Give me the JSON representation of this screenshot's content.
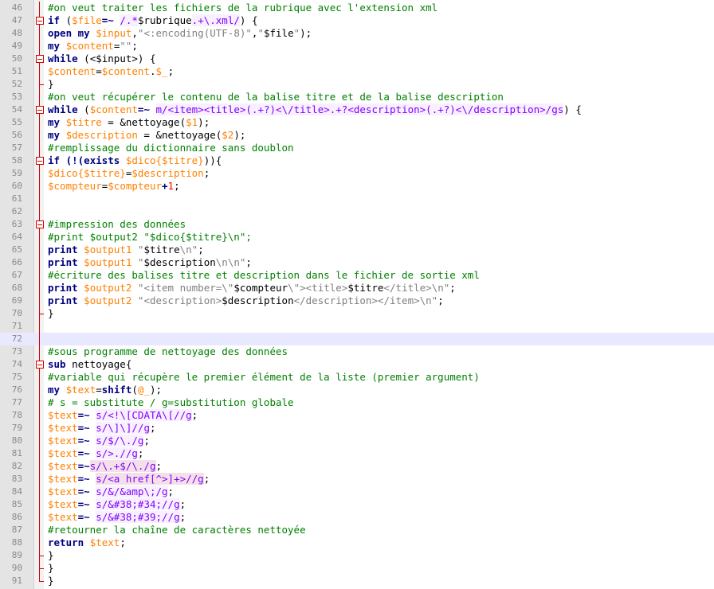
{
  "editor": {
    "colors": {
      "keyword": "#000080",
      "comment": "#008000",
      "variable": "#ff8000",
      "string": "#808080",
      "regex": "#8000ff",
      "fold_marker": "#d00000",
      "current_line": "#e8e8ff",
      "gutter": "#e4e4e4"
    },
    "current_line_number": 72,
    "lines": [
      {
        "n": "46",
        "fold": "line",
        "t": [
          [
            "c",
            "#on veut traiter les fichiers de la rubrique avec l'extension xml"
          ]
        ]
      },
      {
        "n": "47",
        "fold": "open",
        "t": [
          [
            "k",
            "if"
          ],
          [
            "f",
            " ("
          ],
          [
            "v",
            "$file"
          ],
          [
            "o",
            "=~"
          ],
          [
            "f",
            " "
          ],
          [
            "r",
            "/.*"
          ],
          [
            "f",
            "$rubrique"
          ],
          [
            "r",
            ".+\\.xml/"
          ],
          [
            "f",
            ") {"
          ]
        ]
      },
      {
        "n": "48",
        "fold": "line",
        "t": [
          [
            "k",
            "open"
          ],
          [
            "f",
            " "
          ],
          [
            "k",
            "my"
          ],
          [
            "f",
            " "
          ],
          [
            "v",
            "$input"
          ],
          [
            "f",
            ","
          ],
          [
            "s",
            "\"<:encoding(UTF-8)\""
          ],
          [
            "f",
            ","
          ],
          [
            "s",
            "\""
          ],
          [
            "f",
            "$file"
          ],
          [
            "s",
            "\""
          ],
          [
            "f",
            ");"
          ]
        ]
      },
      {
        "n": "49",
        "fold": "line",
        "t": [
          [
            "k",
            "my"
          ],
          [
            "f",
            " "
          ],
          [
            "v",
            "$content"
          ],
          [
            "f",
            "="
          ],
          [
            "s",
            "\"\""
          ],
          [
            "f",
            ";"
          ]
        ]
      },
      {
        "n": "50",
        "fold": "open",
        "t": [
          [
            "k",
            "while"
          ],
          [
            "f",
            " (<"
          ],
          [
            "f",
            "$input"
          ],
          [
            "f",
            ">) {"
          ]
        ]
      },
      {
        "n": "51",
        "fold": "line",
        "t": [
          [
            "v",
            "$content"
          ],
          [
            "f",
            "="
          ],
          [
            "v",
            "$content"
          ],
          [
            "f",
            "."
          ],
          [
            "v",
            "$_"
          ],
          [
            "f",
            ";"
          ]
        ]
      },
      {
        "n": "52",
        "fold": "end",
        "t": [
          [
            "f",
            "}"
          ]
        ]
      },
      {
        "n": "53",
        "fold": "line",
        "t": [
          [
            "c",
            "#on veut récupérer le contenu de la balise titre et de la balise description"
          ]
        ]
      },
      {
        "n": "54",
        "fold": "open",
        "t": [
          [
            "k",
            "while"
          ],
          [
            "f",
            " ("
          ],
          [
            "v",
            "$content"
          ],
          [
            "o",
            "=~"
          ],
          [
            "f",
            " "
          ],
          [
            "r",
            "m/<item><title>(.+?)<\\/title>.+?<description>(.+?)<\\/description>/gs"
          ],
          [
            "f",
            ") {"
          ]
        ]
      },
      {
        "n": "55",
        "fold": "line",
        "t": [
          [
            "k",
            "my"
          ],
          [
            "f",
            " "
          ],
          [
            "v",
            "$titre"
          ],
          [
            "f",
            " = &nettoyage("
          ],
          [
            "v",
            "$1"
          ],
          [
            "f",
            ");"
          ]
        ]
      },
      {
        "n": "56",
        "fold": "line",
        "t": [
          [
            "k",
            "my"
          ],
          [
            "f",
            " "
          ],
          [
            "v",
            "$description"
          ],
          [
            "f",
            " = &nettoyage("
          ],
          [
            "v",
            "$2"
          ],
          [
            "f",
            ");"
          ]
        ]
      },
      {
        "n": "57",
        "fold": "line",
        "t": [
          [
            "c",
            "#remplissage du dictionnaire sans doublon"
          ]
        ]
      },
      {
        "n": "58",
        "fold": "open",
        "t": [
          [
            "k",
            "if"
          ],
          [
            "f",
            " "
          ],
          [
            "o",
            "(!(exists"
          ],
          [
            "f",
            " "
          ],
          [
            "v",
            "$dico{$titre}"
          ],
          [
            "f",
            ")){"
          ]
        ]
      },
      {
        "n": "59",
        "fold": "line",
        "t": [
          [
            "v",
            "$dico{$titre}"
          ],
          [
            "f",
            "="
          ],
          [
            "v",
            "$description"
          ],
          [
            "f",
            ";"
          ]
        ]
      },
      {
        "n": "60",
        "fold": "line",
        "t": [
          [
            "v",
            "$compteur"
          ],
          [
            "f",
            "="
          ],
          [
            "v",
            "$compteur"
          ],
          [
            "o",
            "+"
          ],
          [
            "n",
            "1"
          ],
          [
            "f",
            ";"
          ]
        ]
      },
      {
        "n": "61",
        "fold": "line",
        "t": []
      },
      {
        "n": "62",
        "fold": "line",
        "t": []
      },
      {
        "n": "63",
        "fold": "open",
        "t": [
          [
            "c",
            "#impression des données"
          ]
        ]
      },
      {
        "n": "64",
        "fold": "line",
        "t": [
          [
            "c",
            "#print $output2 \"$dico{$titre}\\n\";"
          ]
        ]
      },
      {
        "n": "65",
        "fold": "line",
        "t": [
          [
            "k",
            "print"
          ],
          [
            "f",
            " "
          ],
          [
            "v",
            "$output1"
          ],
          [
            "f",
            " "
          ],
          [
            "s",
            "\""
          ],
          [
            "f",
            "$titre"
          ],
          [
            "s",
            "\\n\""
          ],
          [
            "f",
            ";"
          ]
        ]
      },
      {
        "n": "66",
        "fold": "line",
        "t": [
          [
            "k",
            "print"
          ],
          [
            "f",
            " "
          ],
          [
            "v",
            "$output1"
          ],
          [
            "f",
            " "
          ],
          [
            "s",
            "\""
          ],
          [
            "f",
            "$description"
          ],
          [
            "s",
            "\\n\\n\""
          ],
          [
            "f",
            ";"
          ]
        ]
      },
      {
        "n": "67",
        "fold": "line",
        "t": [
          [
            "c",
            "#écriture des balises titre et description dans le fichier de sortie xml"
          ]
        ]
      },
      {
        "n": "68",
        "fold": "line",
        "t": [
          [
            "k",
            "print"
          ],
          [
            "f",
            " "
          ],
          [
            "v",
            "$output2"
          ],
          [
            "f",
            " "
          ],
          [
            "s",
            "\"<item number=\\\""
          ],
          [
            "f",
            "$compteur"
          ],
          [
            "s",
            "\\\"><title>"
          ],
          [
            "f",
            "$titre"
          ],
          [
            "s",
            "</title>\\n\""
          ],
          [
            "f",
            ";"
          ]
        ]
      },
      {
        "n": "69",
        "fold": "line",
        "t": [
          [
            "k",
            "print"
          ],
          [
            "f",
            " "
          ],
          [
            "v",
            "$output2"
          ],
          [
            "f",
            " "
          ],
          [
            "s",
            "\"<description>"
          ],
          [
            "f",
            "$description"
          ],
          [
            "s",
            "</description></item>\\n\""
          ],
          [
            "f",
            ";"
          ]
        ]
      },
      {
        "n": "70",
        "fold": "end",
        "t": [
          [
            "f",
            "}"
          ]
        ]
      },
      {
        "n": "71",
        "fold": "line",
        "t": []
      },
      {
        "n": "72",
        "fold": "line",
        "t": []
      },
      {
        "n": "73",
        "fold": "line",
        "t": [
          [
            "c",
            "#sous programme de nettoyage des données"
          ]
        ]
      },
      {
        "n": "74",
        "fold": "open",
        "t": [
          [
            "k",
            "sub"
          ],
          [
            "f",
            " nettoyage{"
          ]
        ]
      },
      {
        "n": "75",
        "fold": "line",
        "t": [
          [
            "c",
            "#variable qui récupère le premier élément de la liste (premier argument)"
          ]
        ]
      },
      {
        "n": "76",
        "fold": "line",
        "t": [
          [
            "k",
            "my"
          ],
          [
            "f",
            " "
          ],
          [
            "v",
            "$text"
          ],
          [
            "f",
            "="
          ],
          [
            "k",
            "shift"
          ],
          [
            "f",
            "("
          ],
          [
            "v",
            "@_"
          ],
          [
            "f",
            ");"
          ]
        ]
      },
      {
        "n": "77",
        "fold": "line",
        "t": [
          [
            "c",
            "# s = substitute / g=substitution globale"
          ]
        ]
      },
      {
        "n": "78",
        "fold": "line",
        "t": [
          [
            "v",
            "$text"
          ],
          [
            "o",
            "=~"
          ],
          [
            "f",
            " "
          ],
          [
            "r",
            "s/<!\\[CDATA\\[//g"
          ],
          [
            "f",
            ";"
          ]
        ]
      },
      {
        "n": "79",
        "fold": "line",
        "t": [
          [
            "v",
            "$text"
          ],
          [
            "o",
            "=~"
          ],
          [
            "f",
            " "
          ],
          [
            "r",
            "s/\\]\\]//g"
          ],
          [
            "f",
            ";"
          ]
        ]
      },
      {
        "n": "80",
        "fold": "line",
        "t": [
          [
            "v",
            "$text"
          ],
          [
            "o",
            "=~"
          ],
          [
            "f",
            " "
          ],
          [
            "r",
            "s/$/\\./g"
          ],
          [
            "f",
            ";"
          ]
        ]
      },
      {
        "n": "81",
        "fold": "line",
        "t": [
          [
            "v",
            "$text"
          ],
          [
            "o",
            "=~"
          ],
          [
            "f",
            " "
          ],
          [
            "r",
            "s/>.//g"
          ],
          [
            "f",
            ";"
          ]
        ]
      },
      {
        "n": "82",
        "fold": "line",
        "t": [
          [
            "v",
            "$text"
          ],
          [
            "o",
            "=~"
          ],
          [
            "rb",
            "s/\\.+$/\\./g"
          ],
          [
            "f",
            ";"
          ]
        ]
      },
      {
        "n": "83",
        "fold": "line",
        "t": [
          [
            "v",
            "$text"
          ],
          [
            "o",
            "=~"
          ],
          [
            "f",
            " "
          ],
          [
            "rb",
            "s/<a href[^>]+>//g"
          ],
          [
            "f",
            ";"
          ]
        ]
      },
      {
        "n": "84",
        "fold": "line",
        "t": [
          [
            "v",
            "$text"
          ],
          [
            "o",
            "=~"
          ],
          [
            "f",
            " "
          ],
          [
            "r",
            "s/&/&amp\\;/g"
          ],
          [
            "f",
            ";"
          ]
        ]
      },
      {
        "n": "85",
        "fold": "line",
        "t": [
          [
            "v",
            "$text"
          ],
          [
            "o",
            "=~"
          ],
          [
            "f",
            " "
          ],
          [
            "r",
            "s/&#38;#34;//g"
          ],
          [
            "f",
            ";"
          ]
        ]
      },
      {
        "n": "86",
        "fold": "line",
        "t": [
          [
            "v",
            "$text"
          ],
          [
            "o",
            "=~"
          ],
          [
            "f",
            " "
          ],
          [
            "r",
            "s/&#38;#39;//g"
          ],
          [
            "f",
            ";"
          ]
        ]
      },
      {
        "n": "87",
        "fold": "line",
        "t": [
          [
            "c",
            "#retourner la chaîne de caractères nettoyée"
          ]
        ]
      },
      {
        "n": "88",
        "fold": "line",
        "t": [
          [
            "k",
            "return"
          ],
          [
            "f",
            " "
          ],
          [
            "v",
            "$text"
          ],
          [
            "f",
            ";"
          ]
        ]
      },
      {
        "n": "89",
        "fold": "end",
        "t": [
          [
            "f",
            "}"
          ]
        ]
      },
      {
        "n": "90",
        "fold": "end",
        "t": [
          [
            "f",
            "}"
          ]
        ]
      },
      {
        "n": "91",
        "fold": "end",
        "t": [
          [
            "f",
            "}"
          ]
        ]
      }
    ]
  }
}
